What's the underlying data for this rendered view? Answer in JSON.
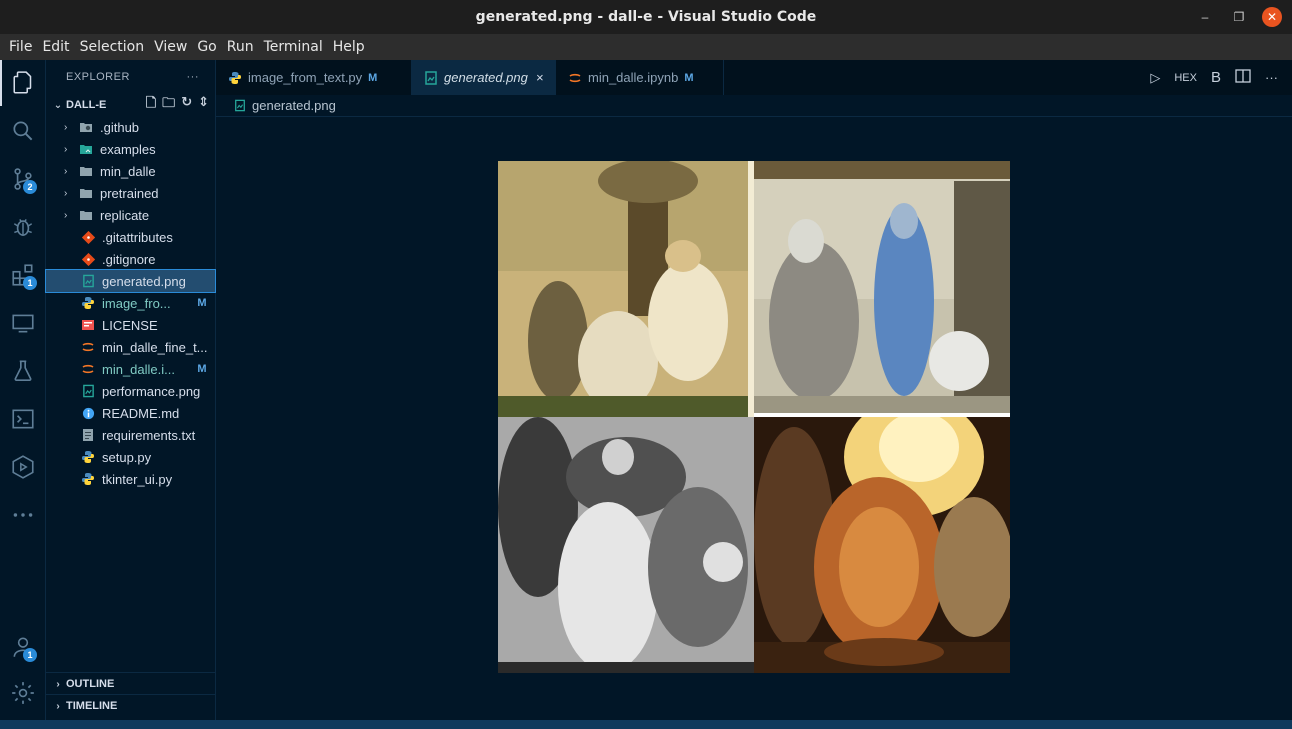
{
  "window": {
    "title": "generated.png - dall-e - Visual Studio Code",
    "minimize": "–",
    "maximize": "❐",
    "close": "✕"
  },
  "menu": [
    "File",
    "Edit",
    "Selection",
    "View",
    "Go",
    "Run",
    "Terminal",
    "Help"
  ],
  "activity": {
    "badges": {
      "source_control": "2",
      "extensions": "1",
      "accounts": "1"
    }
  },
  "sidebar": {
    "header": "EXPLORER",
    "more": "···",
    "folder": "DALL-E",
    "items": [
      {
        "name": ".github",
        "type": "folder",
        "icon": "github-folder-icon"
      },
      {
        "name": "examples",
        "type": "folder",
        "icon": "images-folder-icon"
      },
      {
        "name": "min_dalle",
        "type": "folder",
        "icon": "folder-icon"
      },
      {
        "name": "pretrained",
        "type": "folder",
        "icon": "folder-icon"
      },
      {
        "name": "replicate",
        "type": "folder",
        "icon": "folder-icon"
      },
      {
        "name": ".gitattributes",
        "type": "file",
        "icon": "git-icon"
      },
      {
        "name": ".gitignore",
        "type": "file",
        "icon": "git-icon"
      },
      {
        "name": "generated.png",
        "type": "file",
        "icon": "image-icon",
        "selected": true
      },
      {
        "name": "image_fro...",
        "type": "file",
        "icon": "python-icon",
        "mark": "M",
        "modified": true
      },
      {
        "name": "LICENSE",
        "type": "file",
        "icon": "license-icon"
      },
      {
        "name": "min_dalle_fine_t...",
        "type": "file",
        "icon": "jupyter-icon"
      },
      {
        "name": "min_dalle.i...",
        "type": "file",
        "icon": "jupyter-icon",
        "mark": "M",
        "modified": true
      },
      {
        "name": "performance.png",
        "type": "file",
        "icon": "image-icon"
      },
      {
        "name": "README.md",
        "type": "file",
        "icon": "info-icon"
      },
      {
        "name": "requirements.txt",
        "type": "file",
        "icon": "text-file-icon"
      },
      {
        "name": "setup.py",
        "type": "file",
        "icon": "python-icon"
      },
      {
        "name": "tkinter_ui.py",
        "type": "file",
        "icon": "python-icon"
      }
    ],
    "outline": "OUTLINE",
    "timeline": "TIMELINE"
  },
  "tabs": [
    {
      "label": "image_from_text.py",
      "mark": "M",
      "icon": "python-icon",
      "active": false
    },
    {
      "label": "generated.png",
      "icon": "image-icon",
      "active": true,
      "close": "×"
    },
    {
      "label": "min_dalle.ipynb",
      "mark": "M",
      "icon": "jupyter-icon",
      "active": false
    }
  ],
  "editor_actions": {
    "run": "▷",
    "hex": "HEX",
    "bold": "B",
    "more": "···"
  },
  "breadcrumb": "generated.png",
  "colors": {
    "accent": "#2a8bd8",
    "background": "#011627",
    "selected": "#234d70"
  }
}
